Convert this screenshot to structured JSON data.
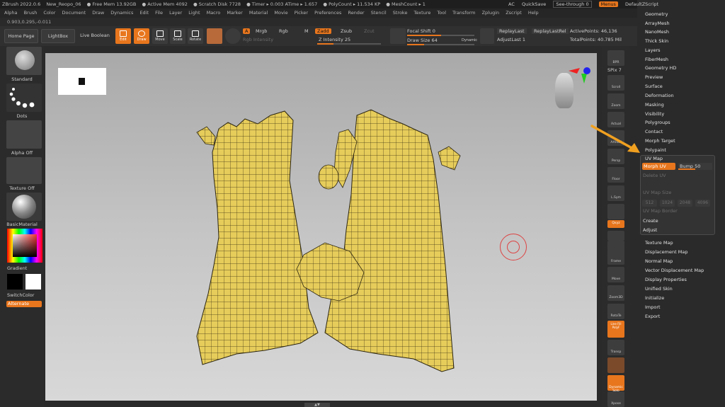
{
  "titlebar": {
    "items": [
      "ZBrush 2022.0.6",
      "New_Reopo_06",
      "● Free Mem 13.92GB",
      "● Active Mem 4092",
      "● Scratch Disk 7728",
      "● Timer ▸ 0.003 ATime ▸ 1.657",
      "● PolyCount ▸ 11.534 KP",
      "● MeshCount ▸ 1"
    ],
    "ac": "AC",
    "quicksave": "QuickSave",
    "seethrough": "See-through  0",
    "menus": "Menus",
    "script": "DefaultZScript"
  },
  "menubar": [
    "Alpha",
    "Brush",
    "Color",
    "Document",
    "Draw",
    "Dynamics",
    "Edit",
    "File",
    "Layer",
    "Light",
    "Macro",
    "Marker",
    "Material",
    "Movie",
    "Picker",
    "Preferences",
    "Render",
    "Stencil",
    "Stroke",
    "Texture",
    "Tool",
    "Transform",
    "Zplugin",
    "Zscript",
    "Help"
  ],
  "coords": "0.903,0.295,-0.011",
  "toolbar": {
    "home": "Home Page",
    "lightbox": "LightBox",
    "liveboolean": "Live Boolean",
    "edit": "Edit",
    "draw": "Draw",
    "move": "Move",
    "scale": "Scale",
    "rotate": "Rotate",
    "a": "A",
    "mrgb": "Mrgb",
    "rgb": "Rgb",
    "m": "M",
    "rgbint": "Rgb Intensity",
    "zadd": "Zadd",
    "zsub": "Zsub",
    "zcut": "Zcut",
    "zint": "Z Intensity 25",
    "focal": "Focal Shift 0",
    "drawsize": "Draw Size 64",
    "dynamic": "Dynamic",
    "replaylast": "ReplayLast",
    "replaylastrel": "ReplayLastRel",
    "adjustlast": "AdjustLast 1",
    "activepoints": "ActivePoints: 46,136",
    "totalpoints": "TotalPoints: 40.785 Mil",
    "zint_frac": 0.25,
    "drawsize_frac": 0.25,
    "focal_frac": 0.5
  },
  "leftshelf": {
    "standard": "Standard",
    "dots": "Dots",
    "alpha": "Alpha Off",
    "texture": "Texture Off",
    "material": "BasicMaterial",
    "gradient": "Gradient",
    "switch": "SwitchColor",
    "alternate": "Alternate"
  },
  "rightshelf": [
    "BPR",
    "SPix 7",
    "Scroll",
    "Zoom",
    "Actual",
    "AAHalf",
    "Persp",
    "Floor",
    "L.Sym",
    "",
    "Qxyz",
    "",
    "",
    "Frame",
    "Move",
    "Zoom3D",
    "RotaTe",
    "Line Fill PolyF",
    "Transp",
    "Ghost",
    "Dynamic Solo",
    "Xpose"
  ],
  "panel": {
    "top": [
      "Geometry",
      "ArrayMesh",
      "NanoMesh",
      "Thick Skin",
      "Layers",
      "FiberMesh",
      "Geometry HD",
      "Preview",
      "Surface",
      "Deformation",
      "Masking",
      "Visibility",
      "Polygroups",
      "Contact",
      "Morph Target",
      "Polypaint"
    ],
    "uv": {
      "title": "UV Map",
      "morph": "Morph UV",
      "bump": "Bump 50",
      "delete": "Delete UV",
      "mapsize": "UV Map Size",
      "sizes": [
        "512",
        "1024",
        "2048",
        "4096"
      ],
      "border": "UV Map Border",
      "create": "Create",
      "adjust": "Adjust"
    },
    "bottom": [
      "Texture Map",
      "Displacement Map",
      "Normal Map",
      "Vector Displacement Map",
      "Display Properties",
      "Unified Skin",
      "Initialize",
      "Import",
      "Export"
    ]
  },
  "colors": {
    "accent": "#e8761d",
    "mesh": "#e6cc5a",
    "arrow": "#f0a020"
  }
}
